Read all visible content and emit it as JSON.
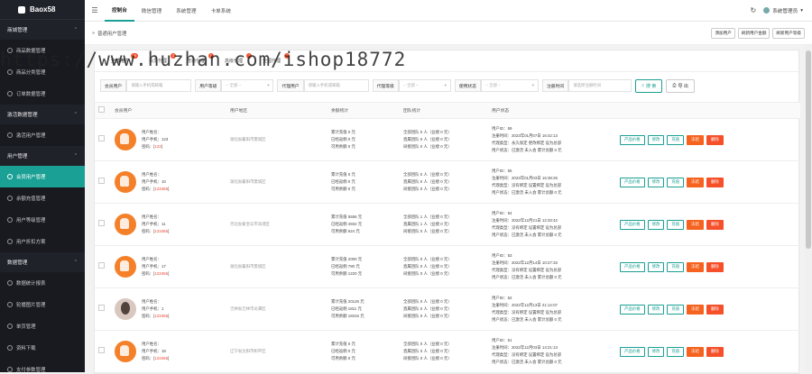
{
  "app": {
    "logo": "Baox58"
  },
  "sidebar": {
    "groups": [
      {
        "label": "商城管理",
        "items": [
          {
            "label": "商品数据管理"
          },
          {
            "label": "商品分类管理"
          },
          {
            "label": "订单数据管理"
          }
        ]
      },
      {
        "label": "激活数据管理",
        "items": [
          {
            "label": "激活用户管理"
          }
        ]
      },
      {
        "label": "用户管理",
        "items": [
          {
            "label": "会员用户管理",
            "active": true
          },
          {
            "label": "余额充值管理"
          },
          {
            "label": "用户等级管理"
          },
          {
            "label": "用户折扣方案"
          }
        ]
      },
      {
        "label": "数据管理",
        "items": [
          {
            "label": "数据统计报表"
          },
          {
            "label": "轮播图片管理"
          },
          {
            "label": "单页管理"
          },
          {
            "label": "资料下载"
          },
          {
            "label": "支付参数管理"
          }
        ]
      }
    ]
  },
  "topbar": {
    "nav": [
      "控制台",
      "微信管理",
      "系统管理",
      "卡单系统"
    ],
    "active_nav": "控制台",
    "user": "系统管理员"
  },
  "subbar": {
    "breadcrumb": "普通用户管理",
    "buttons": [
      "添加用户",
      "刷新用户金额",
      "刷新用户等级"
    ]
  },
  "watermark": "https://www.huzhan.com/ishop18772",
  "tabs": [
    {
      "label": "全部用户",
      "badge": "99"
    },
    {
      "label": "会员代理",
      "badge": "3"
    },
    {
      "label": "普通代理",
      "badge": "8"
    },
    {
      "label": "高级代理",
      "badge": "1"
    },
    {
      "label": "全国代理",
      "badge": "1"
    }
  ],
  "filters": {
    "member_label": "会员用户",
    "member_placeholder": "请输入手机或邮箱",
    "level_label": "用户等级",
    "level_value": "-- 全部 --",
    "agent_label": "代理用户",
    "agent_placeholder": "请输入手机或邮箱",
    "agent_level_label": "代理等级",
    "agent_level_value": "-- 全部 --",
    "status_label": "使用状态",
    "status_value": "-- 全部 --",
    "time_label": "注册时间",
    "time_placeholder": "请选择注册时间",
    "search_label": "搜 索",
    "export_label": "导 出"
  },
  "table": {
    "headers": [
      "会员用户",
      "用户地区",
      "余额统计",
      "团队统计",
      "用户状态",
      ""
    ],
    "rows": [
      {
        "name": "用户姓名：",
        "phone": "用户手机：1",
        "phone_tail": "23",
        "pwd_label": "密码：[",
        "pwd": "123",
        "region": "湖北省襄阳市樊城区",
        "bal": [
          "累计充值 0 元",
          "已经返佣 0 元",
          "可用余额 0 元"
        ],
        "team": [
          "全部团队 0 人（业绩 0 元）",
          "直属团队 0 人（业绩 0 元）",
          "间接团队 0 人（业绩 0 元）"
        ],
        "status": [
          "用户ID：59",
          "注册时间：2023年01月07日 16:42:13",
          "代理类型：永久保定 更改绑定 设为总部",
          "用户状态：已激活 未入会 累计总额 0 元"
        ],
        "ops": [
          "产品价格",
          "修改",
          "充值",
          "冻结",
          "删除"
        ],
        "avatar": "logo"
      },
      {
        "name": "用户姓名：",
        "phone": "用户手机：1",
        "phone_tail": "0",
        "pwd_label": "密码：[",
        "pwd": "123456",
        "region": "湖北省襄阳市樊城区",
        "bal": [
          "累计充值 0 元",
          "已经返佣 0 元",
          "可用余额 0 元"
        ],
        "team": [
          "全部团队 0 人（业绩 0 元）",
          "直属团队 0 人（业绩 0 元）",
          "间接团队 0 人（业绩 0 元）"
        ],
        "status": [
          "用户ID：55",
          "注册时间：2023年01月03日 16:38:26",
          "代理类型：没有绑定 设置绑定 设为总部",
          "用户状态：已激活 未入会 累计总额 0 元"
        ],
        "ops": [
          "产品价格",
          "修改",
          "充值",
          "冻结",
          "删除"
        ],
        "avatar": "logo"
      },
      {
        "name": "用户姓名：",
        "phone": "用户手机：1",
        "phone_tail": "1",
        "pwd_label": "密码：[",
        "pwd": "123456",
        "region": "河北省秦皇岛市海港区",
        "bal": [
          "累计充值 5556 元",
          "已经返佣 4932 元",
          "可用余额 624 元"
        ],
        "team": [
          "全部团队 1 人（业绩 0 元）",
          "直属团队 1 人（业绩 0 元）",
          "间接团队 0 人（业绩 0 元）"
        ],
        "status": [
          "用户ID：54",
          "注册时间：2022年12月21日 12:33:42",
          "代理类型：没有绑定 设置绑定 设为总部",
          "用户状态：已激活 未入会 累计总额 0 元"
        ],
        "ops": [
          "产品价格",
          "修改",
          "充值",
          "冻结",
          "删除"
        ],
        "avatar": "logo"
      },
      {
        "name": "用户姓名：",
        "phone": "用户手机：1",
        "phone_tail": "7",
        "pwd_label": "密码：[",
        "pwd": "123456",
        "region": "湖北省襄阳市樊城区",
        "bal": [
          "累计充值 2000 元",
          "已经返佣 780 元",
          "可用余额 1220 元"
        ],
        "team": [
          "全部团队 0 人（业绩 0 元）",
          "直属团队 0 人（业绩 0 元）",
          "间接团队 0 人（业绩 0 元）"
        ],
        "status": [
          "用户ID：53",
          "注册时间：2022年12月14日 10:27:33",
          "代理类型：没有绑定 设置绑定 设为总部",
          "用户状态：已激活 未入会 累计总额 0 元"
        ],
        "ops": [
          "产品价格",
          "修改",
          "充值",
          "冻结",
          "删除"
        ],
        "avatar": "logo"
      },
      {
        "name": "用户姓名：",
        "phone": "用户手机：1",
        "phone_tail": "",
        "pwd_label": "密码：[",
        "pwd": "123456",
        "region": "吉林省吉林市龙潭区",
        "bal": [
          "累计充值 20126 元",
          "已经返佣 1811 元",
          "可用余额 18315 元"
        ],
        "team": [
          "全部团队 0 人（业绩 0 元）",
          "直属团队 0 人（业绩 0 元）",
          "间接团队 0 人（业绩 0 元）"
        ],
        "status": [
          "用户ID：52",
          "注册时间：2022年12月13日 21:14:07",
          "代理类型：没有绑定 设置绑定 设为总部",
          "用户状态：已激活 未入会 累计总额 0 元"
        ],
        "ops": [
          "产品价格",
          "修改",
          "充值",
          "冻结",
          "删除"
        ],
        "avatar": "photo"
      },
      {
        "name": "用户姓名：",
        "phone": "用户手机：18",
        "phone_tail": "",
        "pwd_label": "密码：[",
        "pwd": "123456",
        "region": "辽宁省沈阳市和平区",
        "bal": [
          "累计充值 0 元",
          "已经返佣 0 元",
          "可用余额 0 元"
        ],
        "team": [
          "全部团队 0 人（业绩 0 元）",
          "直属团队 0 人（业绩 0 元）",
          "间接团队 0 人（业绩 0 元）"
        ],
        "status": [
          "用户ID：51",
          "注册时间：2022年12月03日 14:21:13",
          "代理类型：没有绑定 设置绑定 设为总部",
          "用户状态：已激活 未入会 累计总额 0 元"
        ],
        "ops": [
          "产品价格",
          "修改",
          "充值",
          "冻结",
          "删除"
        ],
        "avatar": "logo"
      }
    ]
  },
  "colors": {
    "accent": "#1aa094",
    "danger": "#f5502a",
    "sidebar": "#20222a"
  }
}
